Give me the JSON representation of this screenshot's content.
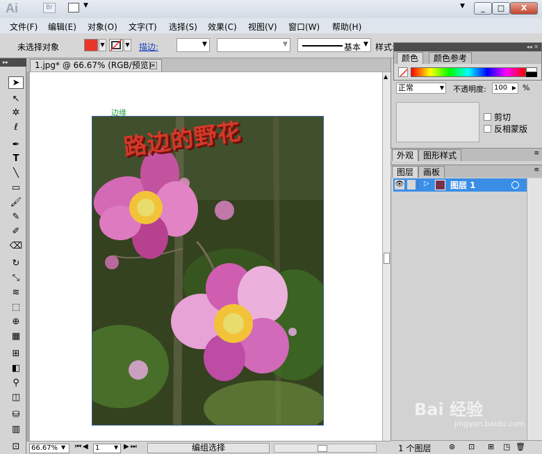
{
  "app": {
    "logo": "Ai",
    "bridge": "Br",
    "close": "X",
    "min": "_",
    "max": "□"
  },
  "menu": [
    "文件(F)",
    "编辑(E)",
    "对象(O)",
    "文字(T)",
    "选择(S)",
    "效果(C)",
    "视图(V)",
    "窗口(W)",
    "帮助(H)"
  ],
  "control": {
    "no_selection": "未选择对象",
    "stroke_label": "描边:",
    "brush_label": "基本",
    "style_label": "样式:"
  },
  "colors": {
    "fill": "#e8362a",
    "accent": "#3a8ee6"
  },
  "document": {
    "tab_title": "1.jpg* @ 66.67% (RGB/预览)",
    "artboard_label": "边缘",
    "photo_text": "路边的野花"
  },
  "status": {
    "zoom": "66.67%",
    "page": "1",
    "label": "编组选择"
  },
  "color_panel": {
    "tab_color": "颜色",
    "tab_color_guide": "颜色参考"
  },
  "transparency": {
    "blend_mode": "正常",
    "opacity_label": "不透明度:",
    "opacity_value": "100",
    "percent": "%",
    "clip": "剪切",
    "invert_mask": "反相蒙版"
  },
  "appearance": {
    "tab_appearance": "外观",
    "tab_graphic_styles": "图形样式"
  },
  "layers": {
    "tab_layers": "图层",
    "tab_artboards": "画板",
    "layer_name": "图层 1",
    "count": "1 个图层"
  },
  "watermark": {
    "main": "Bai 经验",
    "sub": "jingyan.baidu.com"
  }
}
